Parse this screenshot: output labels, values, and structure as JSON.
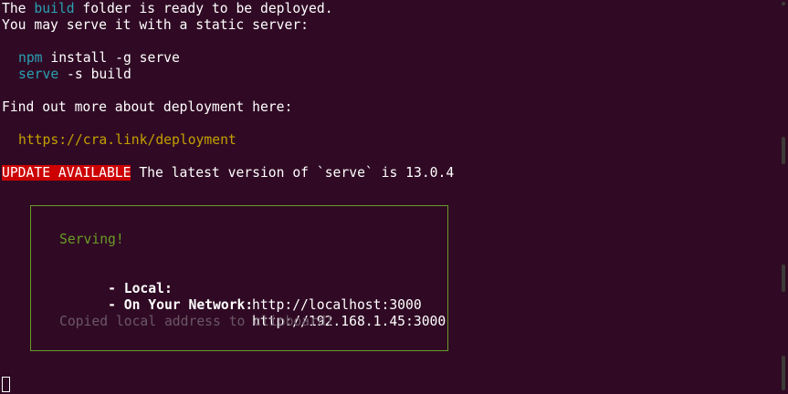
{
  "terminal": {
    "line1": {
      "prefix": "The ",
      "highlight": "build",
      "suffix": " folder is ready to be deployed."
    },
    "line2": "You may serve it with a static server:",
    "cmd1": {
      "keyword": "npm",
      "rest": " install -g serve"
    },
    "cmd2": {
      "keyword": "serve",
      "rest": " -s build"
    },
    "line_deploy": "Find out more about deployment here:",
    "deploy_link": "https://cra.link/deployment",
    "update": {
      "badge": "UPDATE AVAILABLE",
      "message": " The latest version of `serve` is 13.0.4"
    },
    "serve_box": {
      "status": "Serving!",
      "local_label": "- Local:",
      "local_url": "http://localhost:3000",
      "network_label": "- On Your Network:",
      "network_url": "http://192.168.1.45:3000",
      "note": "Copied local address to clipboard!"
    }
  },
  "colors": {
    "background": "#300a24",
    "cyan": "#2aa1b3",
    "link": "#c4a000",
    "badge": "#cc0000",
    "green": "#6a9c26",
    "dim": "#6b5666"
  }
}
